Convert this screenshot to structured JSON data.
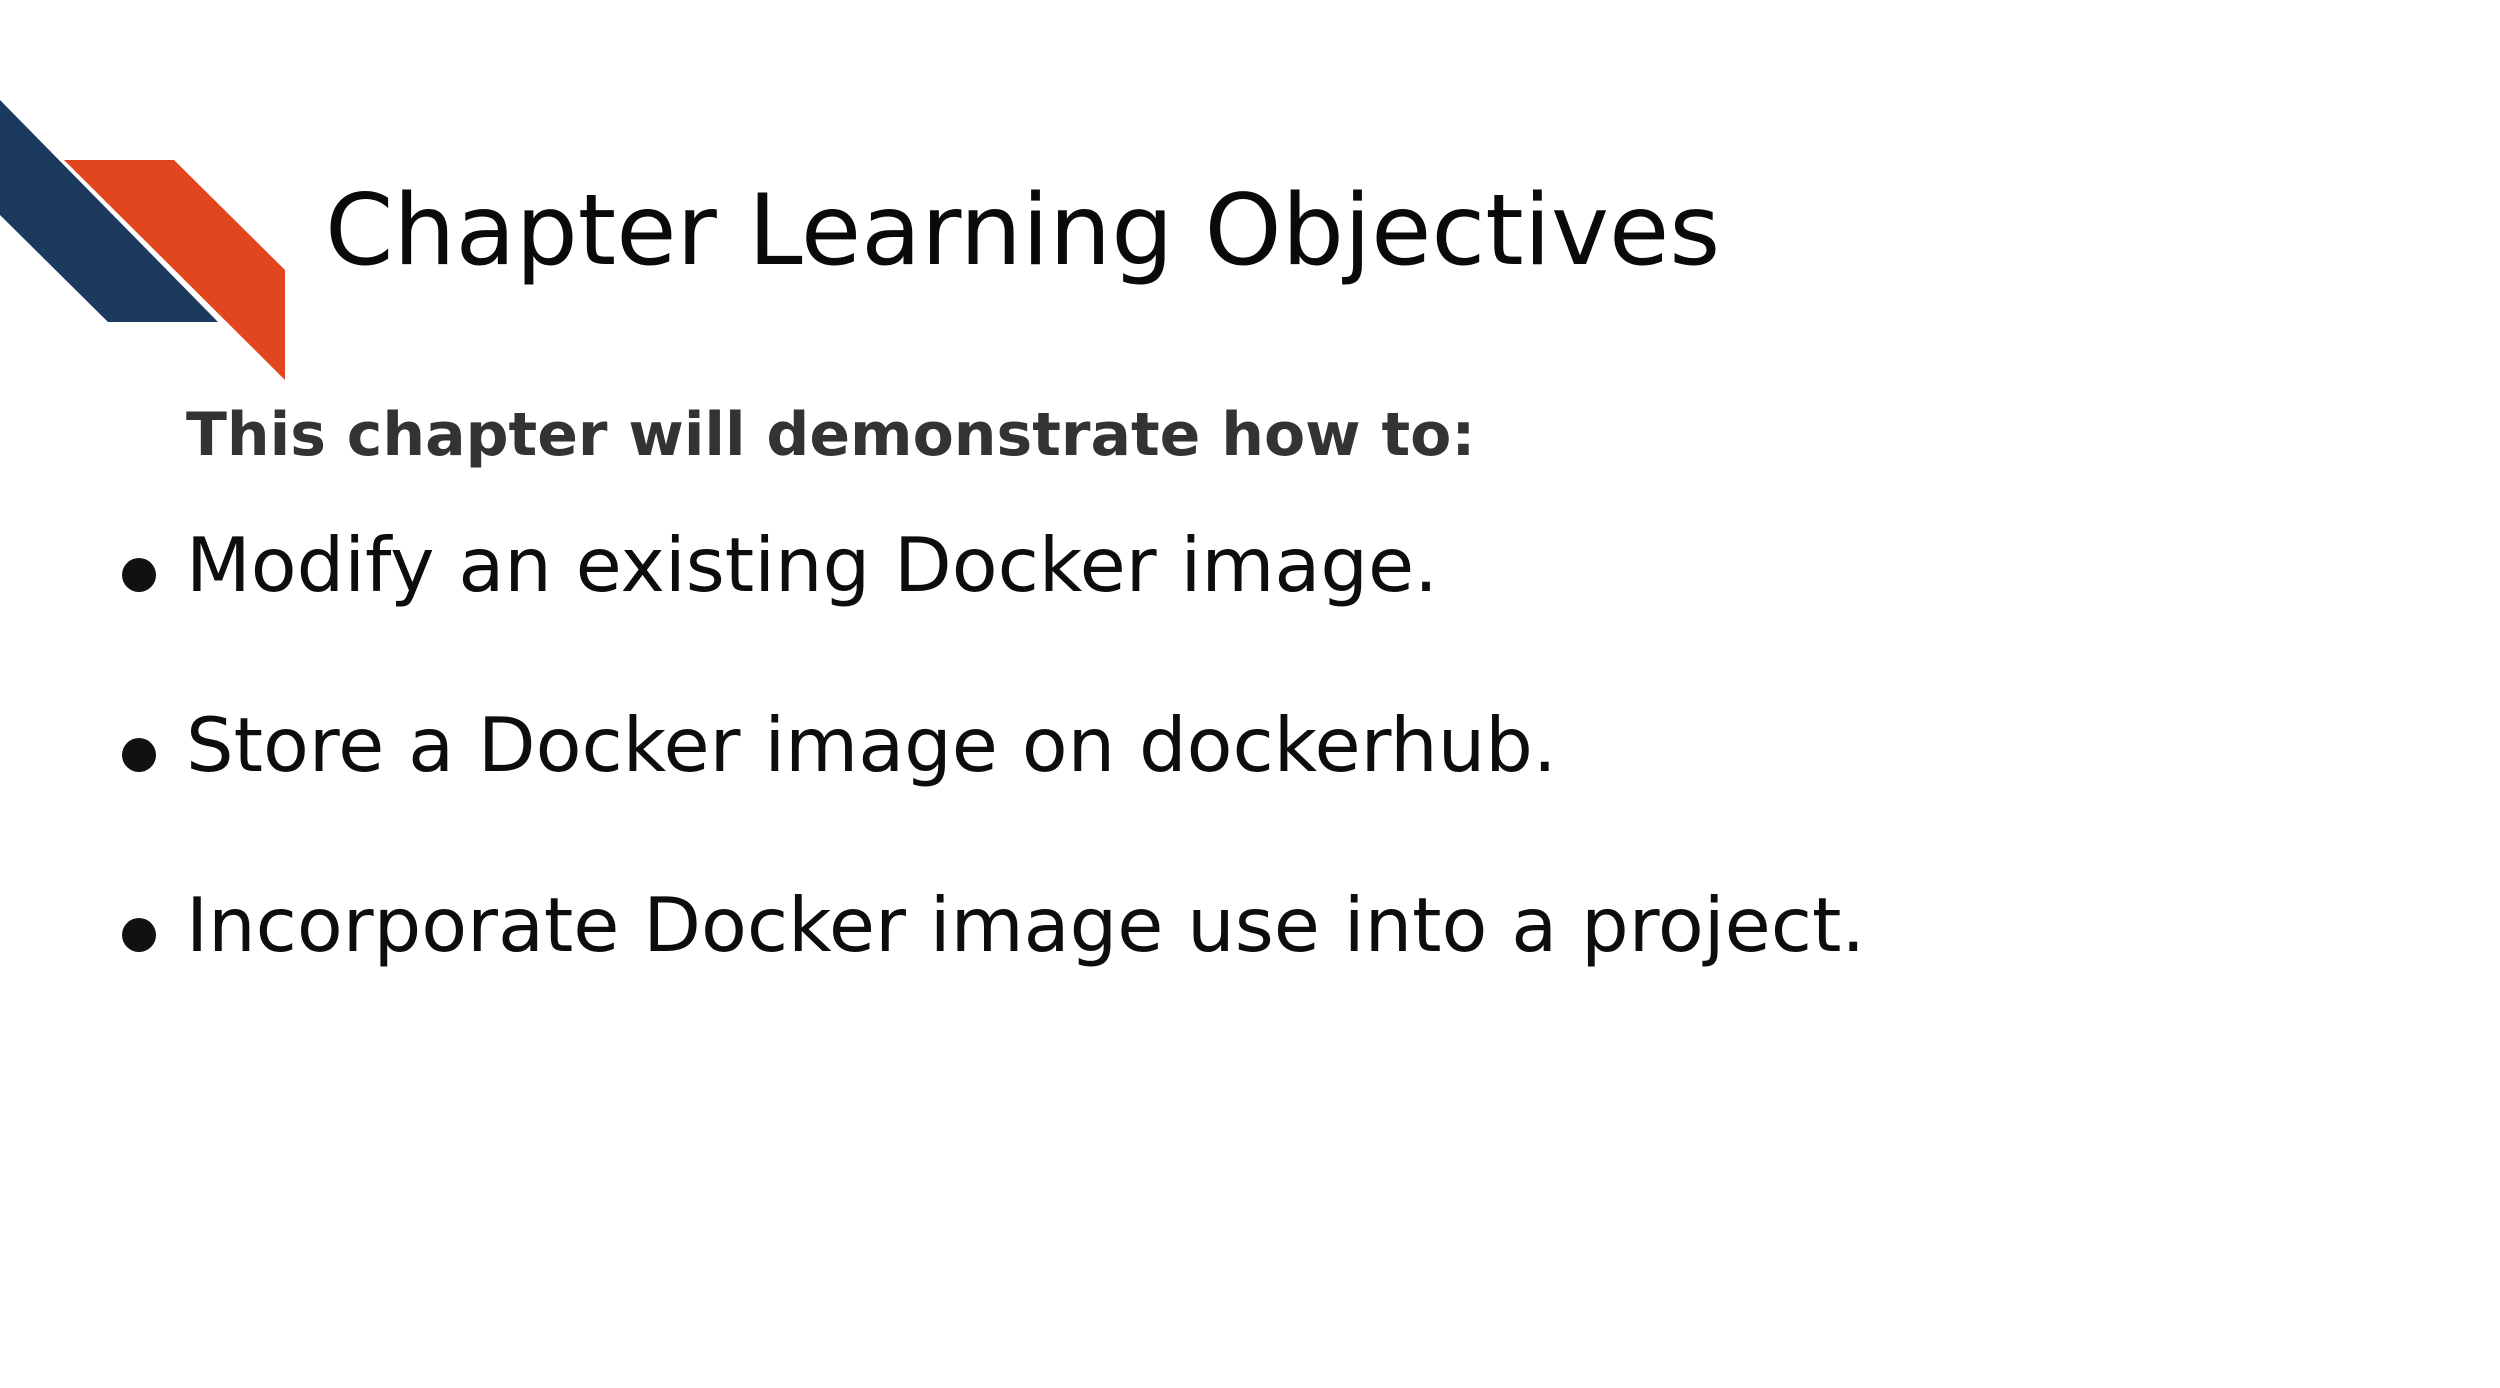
{
  "slide": {
    "title": "Chapter Learning Objectives",
    "intro": "This chapter will demonstrate how to:",
    "objectives": [
      "Modify an existing Docker image.",
      "Store a Docker image on dockerhub.",
      "Incorporate Docker image use into a project."
    ]
  },
  "colors": {
    "accent_navy": "#1c3a5e",
    "accent_orange": "#e1461e",
    "text": "#0d0d0d",
    "intro_text": "#333333",
    "background": "#ffffff"
  },
  "icons": [
    "bullet-dot"
  ]
}
